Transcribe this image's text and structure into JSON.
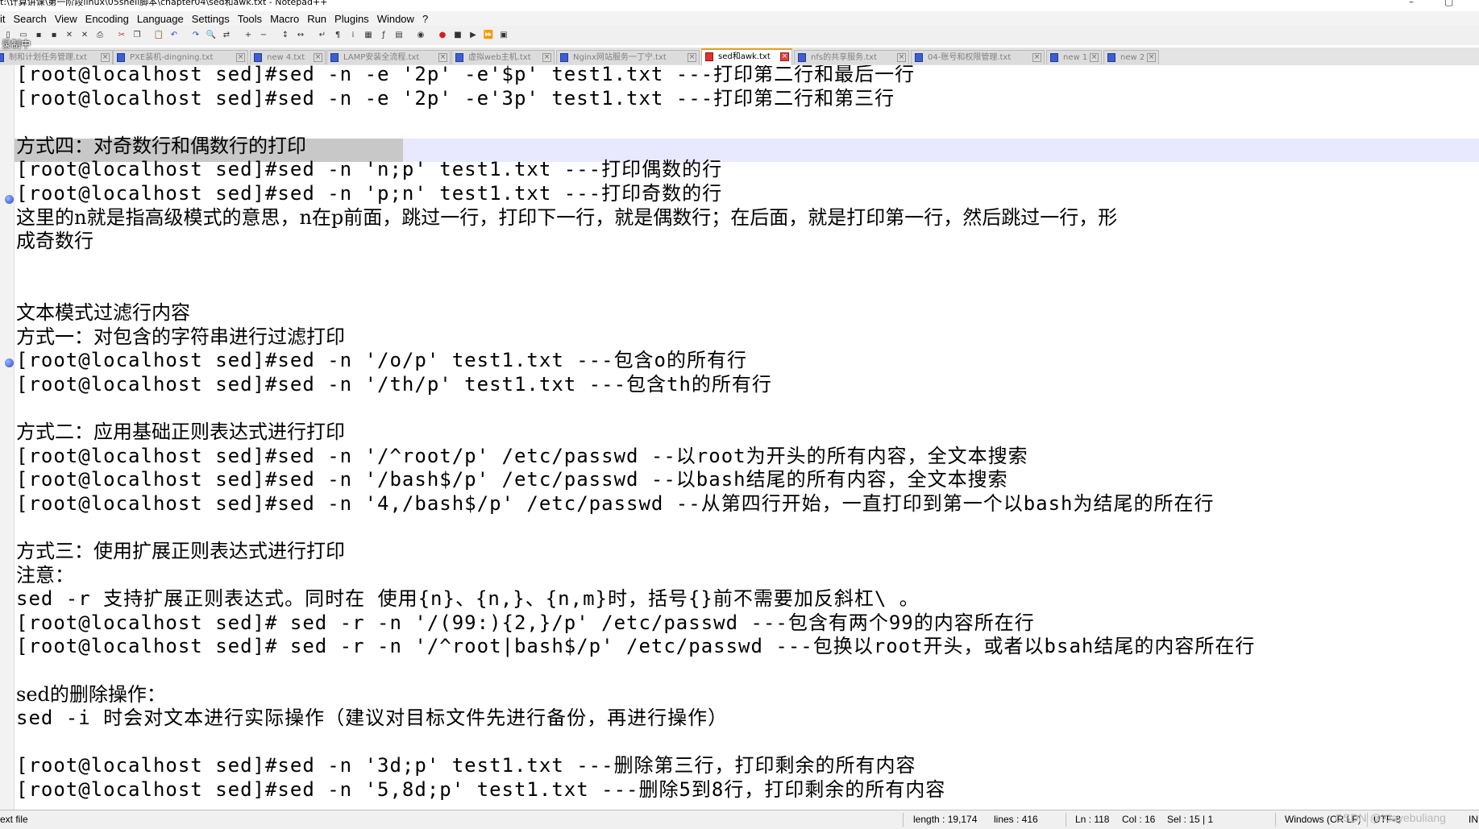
{
  "window": {
    "title": "t:\\计算讲课\\第一阶段linux\\05shell脚本\\chapter04\\sed和awk.txt - Notepad++",
    "controls": [
      "–",
      "▢"
    ]
  },
  "menu": [
    "it",
    "Search",
    "View",
    "Encoding",
    "Language",
    "Settings",
    "Tools",
    "Macro",
    "Run",
    "Plugins",
    "Window",
    "?"
  ],
  "toolbar_icons": [
    "new-file",
    "open-file",
    "save",
    "save-all",
    "close",
    "close-all",
    "print",
    "cut",
    "copy",
    "paste",
    "undo",
    "redo",
    "find",
    "replace",
    "zoom-in",
    "zoom-out",
    "sync-vertical",
    "sync-horizontal",
    "word-wrap",
    "show-all-chars",
    "indent-guide",
    "doc-map",
    "function-list",
    "folder-as-workspace",
    "monitor",
    "record-macro",
    "stop-macro",
    "play-macro",
    "run-macro-multiple",
    "save-macro"
  ],
  "overlay": {
    "recording": "录制中"
  },
  "tabs": [
    {
      "label": "制和计划任务管理.txt",
      "active": false
    },
    {
      "label": "PXE装机-dingning.txt",
      "active": false
    },
    {
      "label": "new 4.txt",
      "active": false
    },
    {
      "label": "LAMP安装全流程.txt",
      "active": false
    },
    {
      "label": "虚拟web主机.txt",
      "active": false
    },
    {
      "label": "Nginx网站服务一丁宁.txt",
      "active": false
    },
    {
      "label": "sed和awk.txt",
      "active": true
    },
    {
      "label": "nfs的共享服务.txt",
      "active": false
    },
    {
      "label": "04-账号和权限管理.txt",
      "active": false
    },
    {
      "label": "new 1",
      "active": false
    },
    {
      "label": "new 2",
      "active": false
    }
  ],
  "lines": [
    "[root@localhost sed]#sed -n -e '2p' -e'$p' test1.txt  ---打印第二行和最后一行",
    "[root@localhost sed]#sed -n -e '2p' -e'3p' test1.txt  ---打印第二行和第三行",
    "",
    "方式四：对奇数行和偶数行的打印",
    "[root@localhost sed]#sed -n 'n;p' test1.txt ---打印偶数的行",
    "[root@localhost sed]#sed -n 'p;n' test1.txt ---打印奇数的行",
    "这里的n就是指高级模式的意思，n在p前面，跳过一行，打印下一行，就是偶数行；在后面，就是打印第一行，然后跳过一行，形",
    "成奇数行",
    "",
    "",
    "文本模式过滤行内容",
    "方式一：对包含的字符串进行过滤打印",
    "[root@localhost sed]#sed -n '/o/p' test1.txt  ---包含o的所有行",
    "[root@localhost sed]#sed -n '/th/p' test1.txt  ---包含th的所有行",
    "",
    "方式二：应用基础正则表达式进行打印",
    "[root@localhost sed]#sed -n  '/^root/p' /etc/passwd  --以root为开头的所有内容，全文本搜索",
    "[root@localhost sed]#sed -n  '/bash$/p' /etc/passwd  --以bash结尾的所有内容，全文本搜索",
    "[root@localhost sed]#sed -n  '4,/bash$/p' /etc/passwd  --从第四行开始，一直打印到第一个以bash为结尾的所在行",
    "",
    "方式三：使用扩展正则表达式进行打印",
    "注意：",
    "sed -r 支持扩展正则表达式。同时在 使用{n}、{n,}、{n,m}时，括号{}前不需要加反斜杠\\ 。",
    "[root@localhost sed]# sed -r -n  '/(99:){2,}/p' /etc/passwd  ---包含有两个99的内容所在行",
    "[root@localhost sed]# sed -r -n  '/^root|bash$/p' /etc/passwd ---包换以root开头，或者以bsah结尾的内容所在行",
    "",
    "sed的删除操作：",
    "sed  -i 时会对文本进行实际操作（建议对目标文件先进行备份，再进行操作）",
    "",
    "[root@localhost sed]#sed -n '3d;p' test1.txt    ---删除第三行，打印剩余的所有内容",
    "[root@localhost sed]#sed -n '5,8d;p' test1.txt   ---删除5到8行，打印剩余的所有内容"
  ],
  "status": {
    "file_type": "ext file",
    "length": "length : 19,174",
    "lines": "lines : 416",
    "ln": "Ln : 118",
    "col": "Col : 16",
    "sel": "Sel : 15 | 1",
    "eol": "Windows (CR LF)",
    "encoding": "UTF-8",
    "ins": "IN",
    "watermark": "CSDN @Xiayebuliang"
  }
}
